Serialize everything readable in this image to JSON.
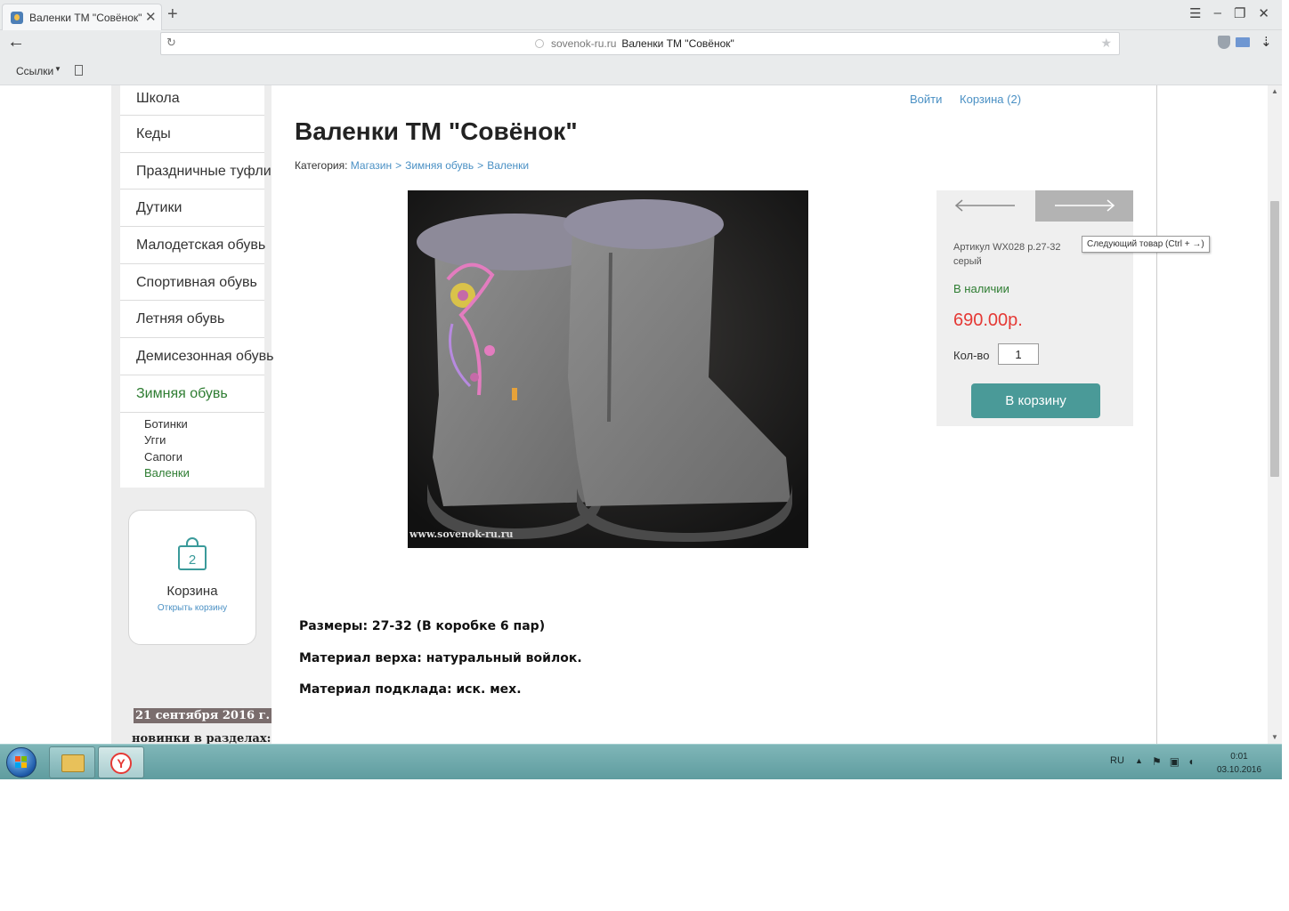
{
  "browser": {
    "tab_title": "Валенки ТМ \"Совёнок\"",
    "tab_close": "✕",
    "new_tab": "+",
    "window_controls": [
      "☰",
      "–",
      "❐",
      "✕"
    ],
    "back": "←",
    "reload": "↻",
    "url_domain": "sovenok-ru.ru",
    "url_page_title": "Валенки ТМ \"Совёнок\"",
    "star": "★",
    "download": "⇣",
    "bookmarks_label": "Ссылки",
    "bookmarks_caret": "▼"
  },
  "sidebar": {
    "menu": [
      {
        "label": "Школа"
      },
      {
        "label": "Кеды"
      },
      {
        "label": "Праздничные туфли"
      },
      {
        "label": "Дутики"
      },
      {
        "label": "Малодетская обувь"
      },
      {
        "label": "Спортивная обувь"
      },
      {
        "label": "Летняя обувь"
      },
      {
        "label": "Демисезонная обувь"
      },
      {
        "label": "Зимняя обувь",
        "active": true
      }
    ],
    "submenu": [
      {
        "label": "Ботинки"
      },
      {
        "label": "Угги"
      },
      {
        "label": "Сапоги"
      },
      {
        "label": "Валенки",
        "active": true
      }
    ],
    "cart_widget": {
      "count": "2",
      "title": "Корзина",
      "link": "Открыть корзину"
    },
    "news": {
      "date": "21 сентября 2016 г.",
      "title": "новинки в разделах:"
    }
  },
  "header_links": {
    "login": "Войти",
    "cart": "Корзина (2)"
  },
  "product": {
    "title": "Валенки ТМ \"Совёнок\"",
    "breadcrumb": {
      "label": "Категория:",
      "items": [
        "Магазин",
        "Зимняя обувь",
        "Валенки"
      ],
      "separator": ">"
    },
    "photo_watermark": "www.sovenok-ru.ru",
    "description": [
      "Размеры: 27-32 (В коробке 6 пар)",
      "Материал верха: натуральный войлок.",
      "Материал подклада: иск. мех."
    ]
  },
  "buy_panel": {
    "sku": "Артикул WX028 р.27-32 серый",
    "stock": "В наличии",
    "price": "690.00р.",
    "qty_label": "Кол-во",
    "qty_value": "1",
    "add_button": "В корзину",
    "tooltip": "Следующий товар (Ctrl + →)"
  },
  "taskbar": {
    "lang": "RU",
    "tray_up": "▲",
    "time": "0:01",
    "date": "03.10.2016"
  },
  "colors": {
    "link": "#4a90c4",
    "active_green": "#2e7d32",
    "price_red": "#e53935",
    "button_teal": "#4a9a98",
    "taskbar": "#6fa8ab"
  },
  "icons": [
    "back-arrow-icon",
    "reload-icon",
    "star-icon",
    "shield-icon",
    "mail-icon",
    "download-icon",
    "bag-icon",
    "arrow-left-icon",
    "arrow-right-icon",
    "start-orb-icon",
    "folder-icon",
    "yandex-browser-icon",
    "flag-icon",
    "network-icon",
    "volume-icon"
  ]
}
